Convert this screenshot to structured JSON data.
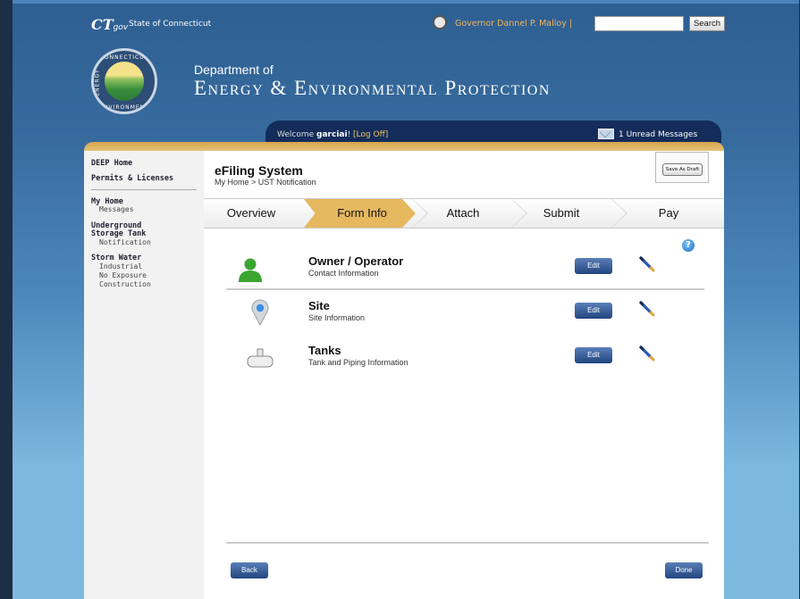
{
  "header": {
    "ct_logo": "CT",
    "ct_logo_suffix": "gov",
    "state": "State of Connecticut",
    "governor": "Governor Dannel P. Malloy |",
    "search_placeholder": "",
    "search_button": "Search"
  },
  "banner": {
    "seal_top": "CONNECTICUT",
    "seal_bottom": "ENVIRONMENT",
    "seal_left": "ENERGY",
    "dept_of": "Department of",
    "dept_name": "Energy & Environmental Protection"
  },
  "userbar": {
    "welcome_prefix": "Welcome ",
    "username": "garciai",
    "welcome_suffix": "! ",
    "logoff": "[Log Off]",
    "unread": "1 Unread Messages"
  },
  "sidebar": {
    "deep_home": "DEEP Home",
    "permits": "Permits & Licenses",
    "my_home": "My Home",
    "messages": "Messages",
    "ust_line1": "Underground",
    "ust_line2": "Storage Tank",
    "notification": "Notification",
    "storm_water": "Storm Water",
    "industrial": "Industrial",
    "no_exposure": "No Exposure",
    "construction": "Construction"
  },
  "content": {
    "title": "eFiling System",
    "breadcrumb": "My Home > UST Notification",
    "save_draft": "Save As Draft",
    "help": "?",
    "tabs": [
      "Overview",
      "Form Info",
      "Attach",
      "Submit",
      "Pay"
    ],
    "active_tab": "Form Info",
    "sections": [
      {
        "title": "Owner / Operator",
        "subtitle": "Contact Information",
        "edit": "Edit",
        "icon": "person-icon"
      },
      {
        "title": "Site",
        "subtitle": "Site Information",
        "edit": "Edit",
        "icon": "map-pin-icon"
      },
      {
        "title": "Tanks",
        "subtitle": "Tank and Piping Information",
        "edit": "Edit",
        "icon": "tank-icon"
      }
    ],
    "back": "Back",
    "done": "Done"
  },
  "colors": {
    "active_tab": "#e6b85f",
    "button_blue": "#21457f",
    "nav_dark": "#142c5a",
    "gold": "#d6a54b",
    "person_green": "#3aa52f"
  }
}
